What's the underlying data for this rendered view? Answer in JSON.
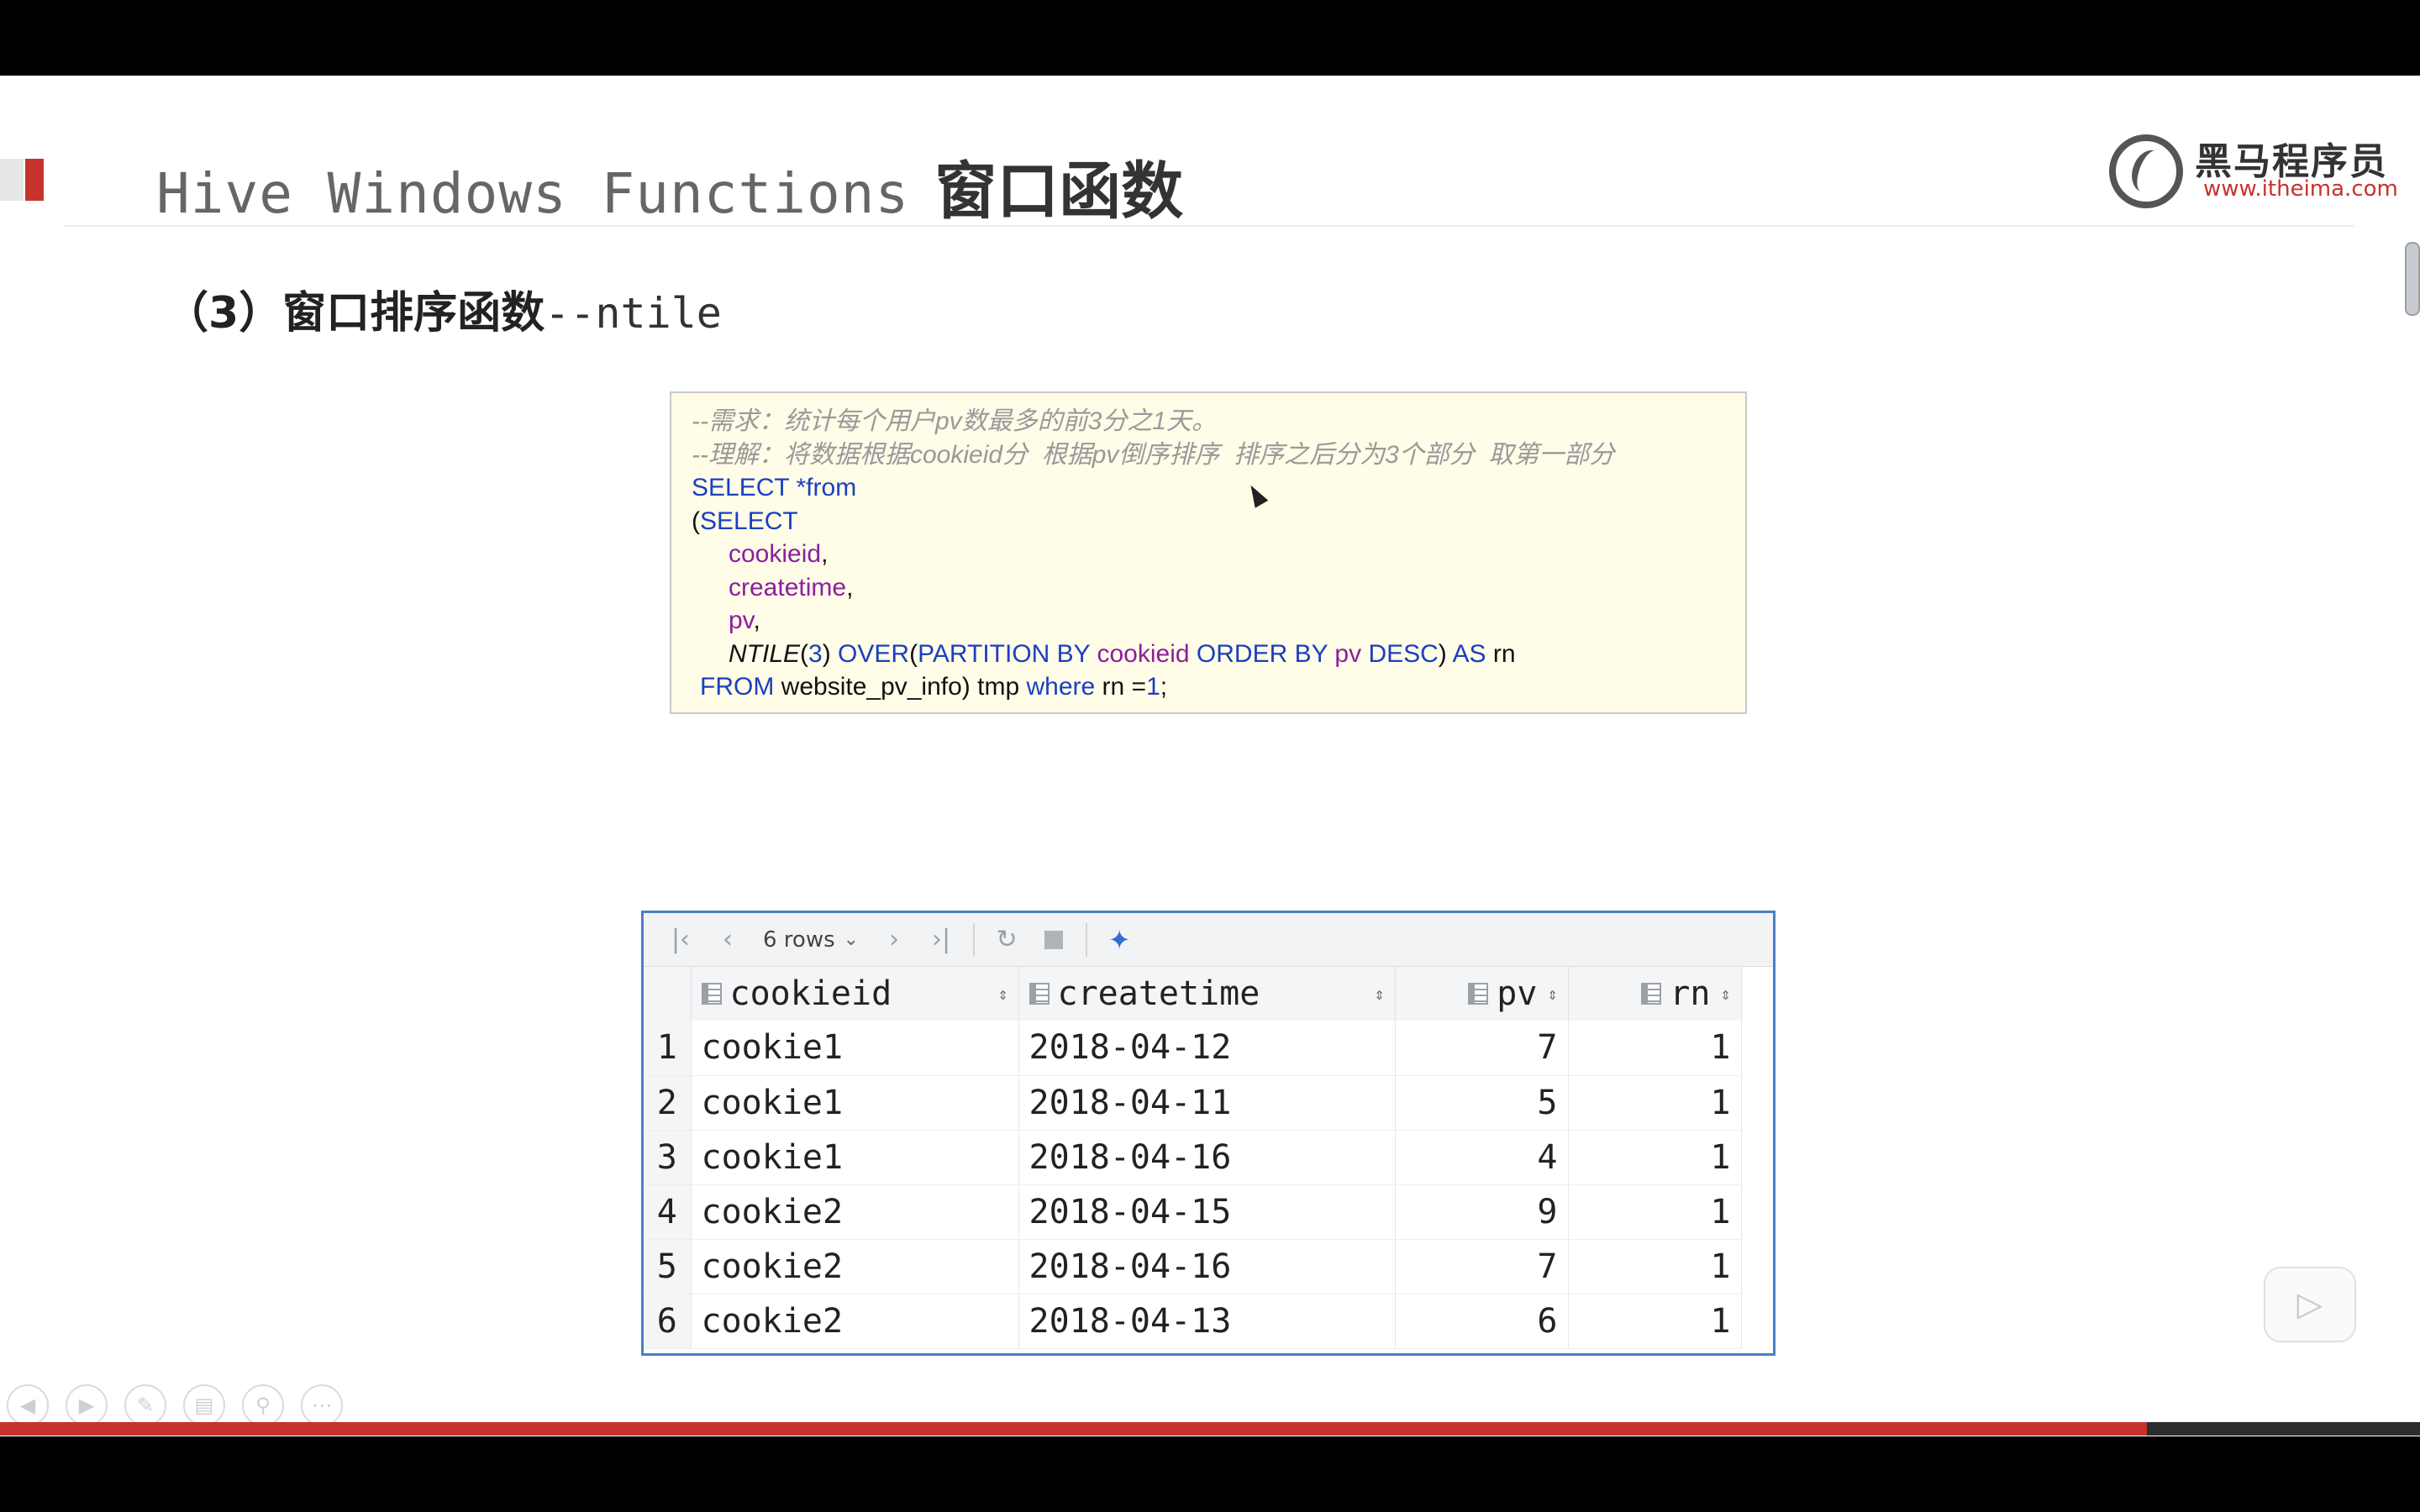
{
  "slide": {
    "title_mono": "Hive Windows Functions",
    "title_cn": "窗口函数",
    "subtitle_cn": "（3）窗口排序函数",
    "subtitle_mono": "--ntile",
    "logo_name": "黑马程序员",
    "logo_url": "www.itheima.com"
  },
  "code": {
    "comment1": "--需求：统计每个用户pv数最多的前3分之1天。",
    "comment2": "--理解：将数据根据cookieid分  根据pv倒序排序  排序之后分为3个部分  取第一部分",
    "select": "SELECT",
    "star_from": " *from",
    "open_paren": "(",
    "select2": "SELECT",
    "col1": "cookieid",
    "comma": ",",
    "col2": "createtime",
    "col3": "pv",
    "fn": "NTILE",
    "fn_arg_open": "(",
    "fn_arg": "3",
    "fn_arg_close": ") ",
    "over": "OVER",
    "partition_open": "(",
    "partition_by": "PARTITION BY",
    "partition_col": "cookieid",
    "order_by": "ORDER BY",
    "order_col": "pv",
    "desc": "DESC",
    "close_as": ") ",
    "as": "AS",
    "alias": " rn",
    "from": "FROM",
    "from_rest": " website_pv_info) tmp ",
    "where": "where",
    "where_rest": " rn =",
    "where_val": "1",
    "semicolon": ";"
  },
  "result": {
    "rows_label": "6 rows",
    "columns": [
      "cookieid",
      "createtime",
      "pv",
      "rn"
    ],
    "rows": [
      {
        "idx": "1",
        "cookieid": "cookie1",
        "createtime": "2018-04-12",
        "pv": "7",
        "rn": "1"
      },
      {
        "idx": "2",
        "cookieid": "cookie1",
        "createtime": "2018-04-11",
        "pv": "5",
        "rn": "1"
      },
      {
        "idx": "3",
        "cookieid": "cookie1",
        "createtime": "2018-04-16",
        "pv": "4",
        "rn": "1"
      },
      {
        "idx": "4",
        "cookieid": "cookie2",
        "createtime": "2018-04-15",
        "pv": "9",
        "rn": "1"
      },
      {
        "idx": "5",
        "cookieid": "cookie2",
        "createtime": "2018-04-16",
        "pv": "7",
        "rn": "1"
      },
      {
        "idx": "6",
        "cookieid": "cookie2",
        "createtime": "2018-04-13",
        "pv": "6",
        "rn": "1"
      }
    ]
  },
  "playback": {
    "progress_fraction": 0.887
  },
  "colors": {
    "accent": "#c6332c",
    "panel_border": "#4a7fc9",
    "keyword": "#1a3fbf",
    "column": "#8b1f9e",
    "code_bg": "#fffce8"
  }
}
